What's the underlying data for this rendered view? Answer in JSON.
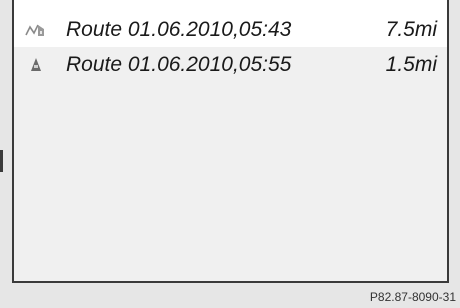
{
  "routes": [
    {
      "icon": "route-track-icon",
      "name": "Route 01.06.2010,05:43",
      "distance": "7.5mi",
      "selected": true
    },
    {
      "icon": "route-marker-icon",
      "name": "Route 01.06.2010,05:55",
      "distance": "1.5mi",
      "selected": false
    }
  ],
  "footer": {
    "ref_code": "P82.87-8090-31"
  }
}
